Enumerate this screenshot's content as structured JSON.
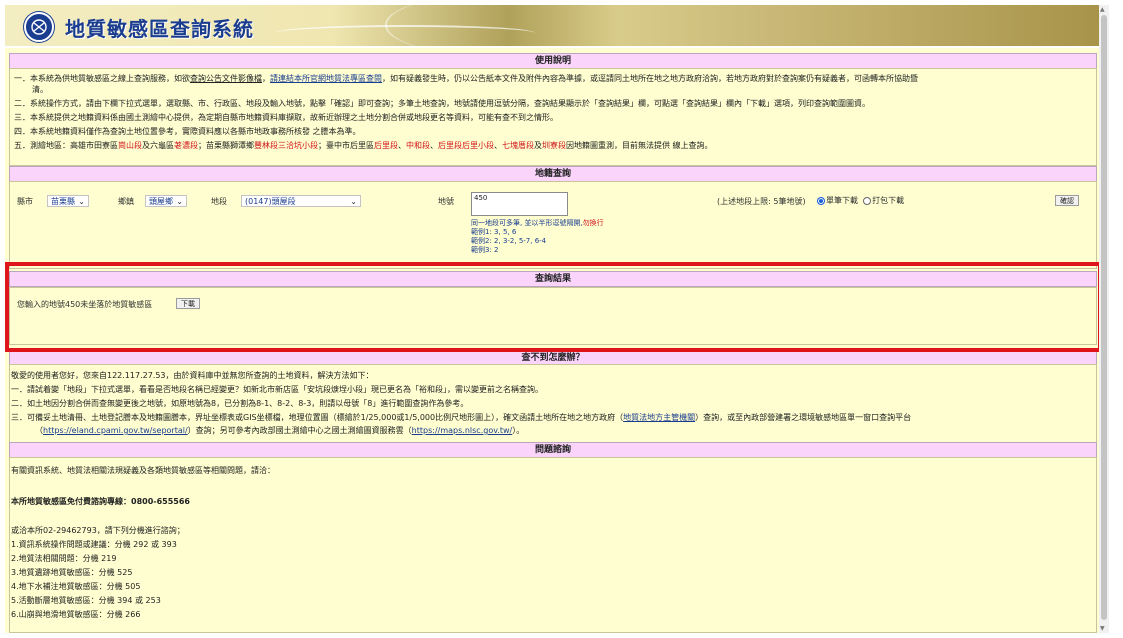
{
  "banner": {
    "title": "地質敏感區查詢系統"
  },
  "usage": {
    "header": "使用說明",
    "lines": [
      {
        "num": "一．",
        "pre": "本系統為供地質敏感區之線上查詢服務，如欲",
        "link1": "查詢公告文件影像檔",
        "mid1": "，",
        "link2": "請連結本所官網地質法專區查閱",
        "post": "，如有疑義發生時，仍以公告紙本文件及附件內容為準據，或逕請同土地所在地之地方政府洽詢，若地方政府對於查詢案仍有疑義者，可函轉本所協助暨"
      },
      {
        "cont": "清。"
      },
      {
        "num": "二．",
        "text": "系統操作方式，請由下欄下拉式選單，選取縣、市、行政區、地段及輸入地號，點擊「確認」即可查詢；多筆土地查詢，地號請使用逗號分隔，查詢結果顯示於「查詢結果」欄，可點選「查詢結果」欄內「下載」選項，列印查詢範圍圖資。"
      },
      {
        "num": "三．",
        "text": "本系統提供之地籍資料係由國土測繪中心提供，為定期自縣市地籍資料庫擷取，故新近辦理之土地分割合併或地段更名等資料，可能有查不到之情形。"
      },
      {
        "num": "四．",
        "text": "本系統地籍資料僅作為查詢土地位置參考，實際資料應以各縣市地政事務所核發 之謄本為準。"
      },
      {
        "num": "五．",
        "pre": "測繪地區：高雄市田寮區",
        "r1": "崗山段",
        "a1": "及六龜區",
        "r2": "荖濃段",
        "a2": "；苗栗縣獅潭鄉",
        "r3": "豐林段三洽坑小段",
        "a3": "；臺中市后里區",
        "r4": "后里段",
        "a4": "、",
        "r5": "中和段",
        "a5": "、",
        "r6": "后里段后里小段",
        "a6": "、",
        "r7": "七塊厝段",
        "a7": "及",
        "r8": "圳寮段",
        "post": "因地籍圖重測，目前無法提供 線上查詢。"
      }
    ]
  },
  "cadastral": {
    "header": "地籍查詢",
    "county_label": "縣市",
    "county_value": "苗栗縣",
    "township_label": "鄉鎮",
    "township_value": "頭屋鄉",
    "section_label": "地段",
    "section_value": "(0147)頭屋段",
    "lot_label": "地號",
    "lot_value": "450",
    "note": "同一地段可多筆, 並以半形逗號隔開,",
    "note_red": "勿換行",
    "example1": "範例1: 3, 5, 6",
    "example2": "範例2: 2, 3-2, 5-7, 6-4",
    "example3": "範例3: 2",
    "limit_text": "(上述地段上限: 5筆地號)",
    "opt_single": "單筆下載",
    "opt_package": "打包下載",
    "confirm": "確認"
  },
  "result": {
    "header": "查詢結果",
    "message": "您輸入的地號450未坐落於地質敏感區",
    "download": "下載"
  },
  "notfound": {
    "header": "查不到怎麼辦？",
    "intro": "敬愛的使用者您好，您來自122.117.27.53，由於資料庫中並無您所查詢的土地資料，解決方法如下：",
    "l1": "一．請試着變「地段」下拉式選單，看看是否地段名稱已經變更？如新北市新店區「安坑段焿埕小段」現已更名為「裕和段」，需以變更前之名稱查詢。",
    "l2": "二．如土地因分割合併而查無變更後之地號，如原地號為8，已分割為8-1、8-2、8-3，則請以母號「8」進行範圍查詢作為參考。",
    "l3_pre": "三．可備妥土地清冊、土地登記謄本及地籍圖謄本，界址坐標表或GIS坐標檔，地理位置圖（標繪於1/25,000或1/5,000比例尺地形圖上），確文函請土地所在地之地方政府（",
    "l3_link": "地質法地方主管機關",
    "l3_post": "）查詢，或至內政部營建署之環境敏感地區單一窗口查詢平台",
    "l4_pre": "（",
    "l4_link1": "https://eland.cpami.gov.tw/seportal/",
    "l4_mid": "）查詢；另可參考內政部國土測繪中心之國土測繪圖資服務雲（",
    "l4_link2": "https://maps.nlsc.gov.tw/",
    "l4_post": "）。"
  },
  "consult": {
    "header": "問題諮詢",
    "intro": "有關資訊系統、地質法相關法規疑義及各類地質敏感區等相關問題，請洽：",
    "hotline": "本所地質敏感區免付費諮詢專線：0800-655566",
    "phone_line": "或洽本所02-29462793，請下列分機進行諮詢；",
    "items": [
      "1.資訊系統操作問題或建議：分機 292 或 393",
      "2.地質法相關問題：分機 219",
      "3.地質遺跡地質敏感區：分機 525",
      "4.地下水補注地質敏感區：分機 505",
      "5.活動斷層地質敏感區：分機 394 或 253",
      "6.山崩與地滑地質敏感區：分機 266"
    ]
  }
}
